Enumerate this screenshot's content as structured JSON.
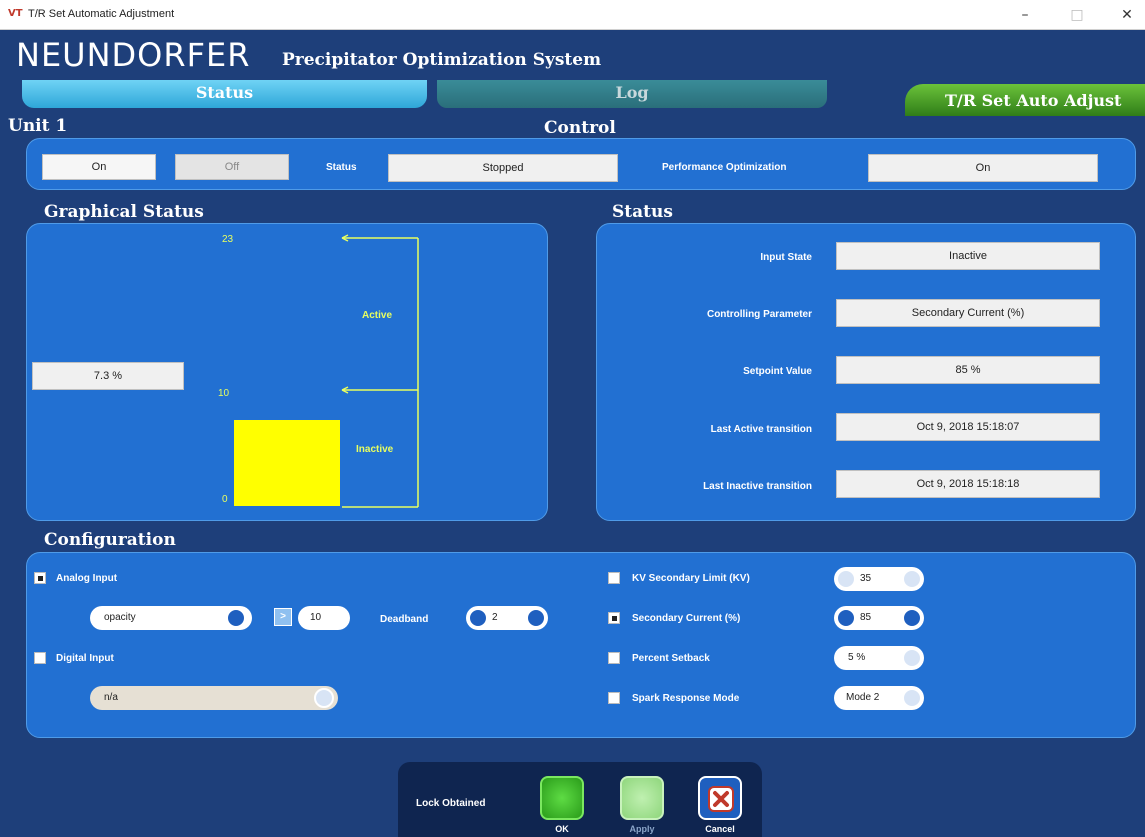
{
  "window": {
    "title": "T/R Set Automatic Adjustment",
    "icon_text": "VT",
    "min": "–",
    "max": "□",
    "close": "✕"
  },
  "header": {
    "brand": "NEUNDORFER",
    "subtitle": "Precipitator Optimization System"
  },
  "tabs": {
    "status": "Status",
    "log": "Log",
    "tr": "T/R Set Auto Adjust"
  },
  "unit": "Unit 1",
  "control": {
    "title": "Control",
    "on_label": "On",
    "off_label": "Off",
    "status_label": "Status",
    "status_value": "Stopped",
    "perf_label": "Performance Optimization",
    "perf_value": "On"
  },
  "graphical": {
    "title": "Graphical Status",
    "value_text": "7.3 %",
    "tick_top": "23",
    "tick_mid": "10",
    "tick_bottom": "0",
    "active_label": "Active",
    "inactive_label": "Inactive",
    "bar_value": 7.3,
    "axis_max": 23,
    "threshold": 10,
    "bar_color": "#ffff00"
  },
  "status": {
    "title": "Status",
    "rows": [
      {
        "label": "Input State",
        "value": "Inactive"
      },
      {
        "label": "Controlling Parameter",
        "value": "Secondary Current (%)"
      },
      {
        "label": "Setpoint Value",
        "value": "85 %"
      },
      {
        "label": "Last Active transition",
        "value": "Oct 9, 2018 15:18:07"
      },
      {
        "label": "Last Inactive transition",
        "value": "Oct 9, 2018 15:18:18"
      }
    ]
  },
  "config": {
    "title": "Configuration",
    "analog_label": "Analog Input",
    "analog_checked": true,
    "analog_select": "opacity",
    "compare_symbol": ">",
    "threshold_value": "10",
    "deadband_label": "Deadband",
    "deadband_value": "2",
    "digital_label": "Digital Input",
    "digital_checked": false,
    "digital_select": "n/a",
    "kv_label": "KV Secondary Limit (KV)",
    "kv_value": "35",
    "kv_checked": false,
    "sc_label": "Secondary Current (%)",
    "sc_value": "85",
    "sc_checked": true,
    "ps_label": "Percent Setback",
    "ps_value": "5 %",
    "ps_checked": false,
    "srm_label": "Spark Response Mode",
    "srm_value": "Mode 2",
    "srm_checked": false
  },
  "footer": {
    "lock": "Lock Obtained",
    "ok": "OK",
    "apply": "Apply",
    "cancel": "Cancel"
  },
  "colors": {
    "background": "#1e3f7a",
    "panel": "#2270d2",
    "highlight_line": "#e8ff60",
    "ok": "#3fbf2a",
    "apply": "#9fe08e",
    "cancel": "#c0392b"
  }
}
